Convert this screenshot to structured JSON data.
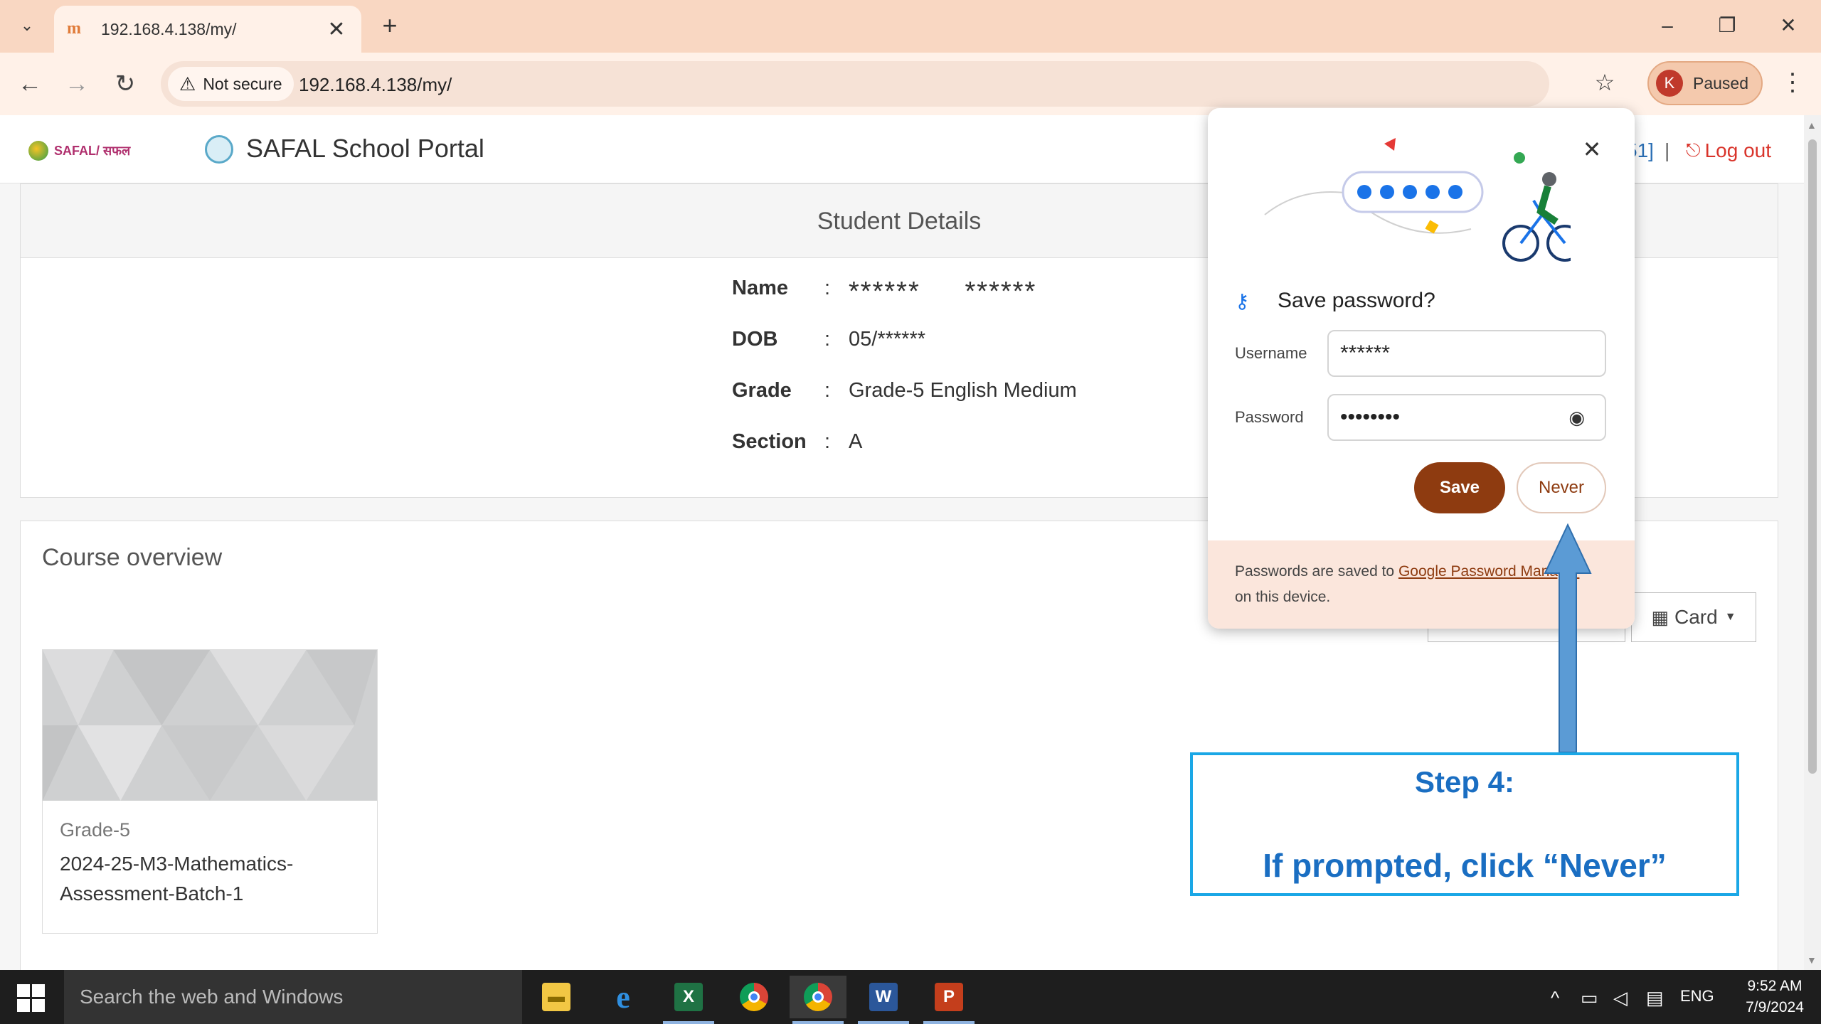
{
  "browser": {
    "tab_title": "192.168.4.138/my/",
    "tab_close": "✕",
    "new_tab": "+",
    "security_label": "Not secure",
    "url": "192.168.4.138/my/",
    "profile_initial": "K",
    "profile_status": "Paused"
  },
  "site": {
    "portal_title": "SAFAL School Portal",
    "logo_text": "SAFAL/ सफल",
    "user_partial": "51]",
    "separator": "|",
    "logout_label": "Log out"
  },
  "student_details": {
    "heading": "Student Details",
    "rows": [
      {
        "label": "Name",
        "colon": ":",
        "value": "******     ******"
      },
      {
        "label": "DOB",
        "colon": ":",
        "value": "05/******"
      },
      {
        "label": "Grade",
        "colon": ":",
        "value": "Grade-5 English Medium"
      },
      {
        "label": "Section",
        "colon": ":",
        "value": "A"
      }
    ]
  },
  "course_overview": {
    "heading": "Course overview",
    "view_button": "Card",
    "course": {
      "category": "Grade-5",
      "name": "2024-25-M3-Mathematics-Assessment-Batch-1"
    }
  },
  "password_popup": {
    "title": "Save password?",
    "username_label": "Username",
    "username_value": "******",
    "password_label": "Password",
    "password_value": "••••••••",
    "save_label": "Save",
    "never_label": "Never",
    "footer_text_1": "Passwords are saved to ",
    "footer_link": "Google Password Manager",
    "footer_text_2": "on this device."
  },
  "annotation": {
    "step_title": "Step 4:",
    "step_text": "If prompted, click “Never”",
    "color": "#1a6ec2",
    "box_color": "#1aa7e6"
  },
  "taskbar": {
    "search_placeholder": "Search the web and Windows",
    "language": "ENG",
    "time": "9:52 AM",
    "date": "7/9/2024"
  },
  "colors": {
    "tabstrip": "#f9d7c2",
    "toolbar": "#fff1e8",
    "save_button": "#8e3b10",
    "logout": "#d9342b"
  }
}
